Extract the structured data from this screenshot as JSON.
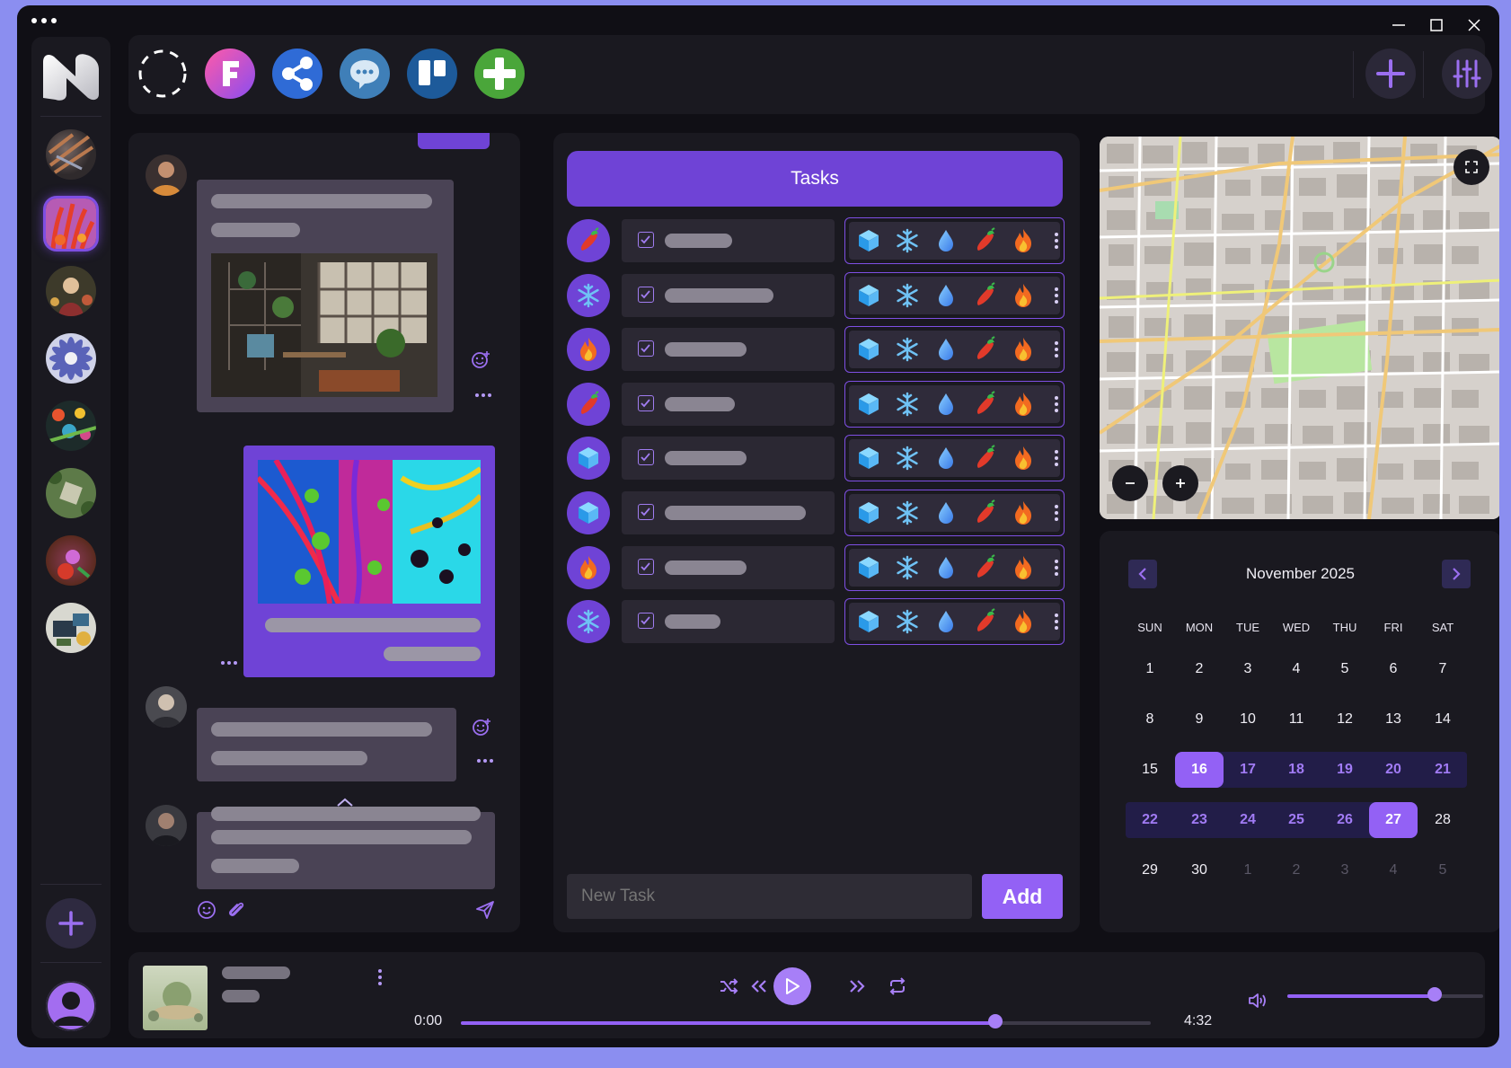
{
  "tasks": {
    "title": "Tasks",
    "new_task_placeholder": "New Task",
    "add_label": "Add",
    "rows": [
      {
        "icon": "chili",
        "checked": true
      },
      {
        "icon": "snowflake",
        "checked": true
      },
      {
        "icon": "fire",
        "checked": true
      },
      {
        "icon": "chili",
        "checked": true
      },
      {
        "icon": "cube",
        "checked": true
      },
      {
        "icon": "cube",
        "checked": true
      },
      {
        "icon": "fire",
        "checked": true
      },
      {
        "icon": "snowflake",
        "checked": true
      }
    ],
    "tag_icons": [
      "cube",
      "snowflake",
      "water-drop",
      "chili",
      "fire"
    ]
  },
  "calendar": {
    "month_label": "November 2025",
    "weekdays": [
      "SUN",
      "MON",
      "TUE",
      "WED",
      "THU",
      "FRI",
      "SAT"
    ],
    "weeks": [
      [
        "1",
        "2",
        "3",
        "4",
        "5",
        "6",
        "7"
      ],
      [
        "8",
        "9",
        "10",
        "11",
        "12",
        "13",
        "14"
      ],
      [
        "15",
        "16",
        "17",
        "18",
        "19",
        "20",
        "21"
      ],
      [
        "22",
        "23",
        "24",
        "25",
        "26",
        "27",
        "28"
      ],
      [
        "29",
        "30",
        "1",
        "2",
        "3",
        "4",
        "5"
      ]
    ],
    "range_start": "16",
    "range_end": "27"
  },
  "player": {
    "elapsed": "0:00",
    "duration": "4:32",
    "progress": 0.775,
    "volume": 0.75
  },
  "topbar": {
    "apps": [
      "loading-icon",
      "f-app-icon",
      "share-icon",
      "chat-bubble-icon",
      "trello-icon",
      "plus-app-icon"
    ]
  },
  "colors": {
    "accent": "#6f43d6",
    "accent_light": "#9361f5",
    "panel": "#1a1920",
    "window": "#100f15",
    "backdrop": "#8b8ef0"
  }
}
